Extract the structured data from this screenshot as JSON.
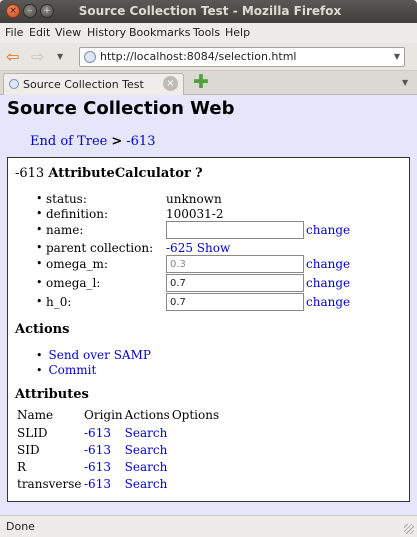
{
  "window": {
    "title": "Source Collection Test - Mozilla Firefox",
    "close_glyph": "×",
    "min_glyph": "–",
    "max_glyph": "+"
  },
  "menu": [
    "File",
    "Edit",
    "View",
    "History",
    "Bookmarks",
    "Tools",
    "Help"
  ],
  "nav": {
    "url": "http://localhost:8084/selection.html",
    "back_glyph": "⇦",
    "forward_glyph": "⇨",
    "dropdown_glyph": "▼"
  },
  "tab": {
    "label": "Source Collection Test",
    "close_glyph": "×",
    "new_tab_glyph": "✚"
  },
  "page": {
    "title": "Source Collection Web",
    "breadcrumb": {
      "root": "End of Tree",
      "sep": ">",
      "current": "-613"
    },
    "node": {
      "id": "-613",
      "name": "AttributeCalculator",
      "help": "?"
    },
    "bullet": "•",
    "attributes": [
      {
        "key": "status:",
        "value": "unknown"
      },
      {
        "key": "definition:",
        "value": "100031-2"
      },
      {
        "key": "name:",
        "input": "",
        "action": "change"
      },
      {
        "key": "parent collection:",
        "value": "-625",
        "link": "Show"
      },
      {
        "key": "omega_m:",
        "input": "0.3",
        "action": "change"
      },
      {
        "key": "omega_l:",
        "input": "0.7",
        "action": "change"
      },
      {
        "key": "h_0:",
        "input": "0.7",
        "action": "change"
      }
    ],
    "actions_heading": "Actions",
    "actions": [
      "Send over SAMP",
      "Commit"
    ],
    "attributes_heading": "Attributes",
    "table": {
      "headers": [
        "Name",
        "Origin",
        "Actions",
        "Options"
      ],
      "rows": [
        {
          "name": "SLID",
          "origin": "-613",
          "action": "Search"
        },
        {
          "name": "SID",
          "origin": "-613",
          "action": "Search"
        },
        {
          "name": "R",
          "origin": "-613",
          "action": "Search"
        },
        {
          "name": "transverse",
          "origin": "-613",
          "action": "Search"
        }
      ]
    }
  },
  "status": {
    "text": "Done"
  },
  "colors": {
    "page_bg": "#e6e6fa",
    "link": "#0000cc",
    "accent": "#e46c1c"
  }
}
